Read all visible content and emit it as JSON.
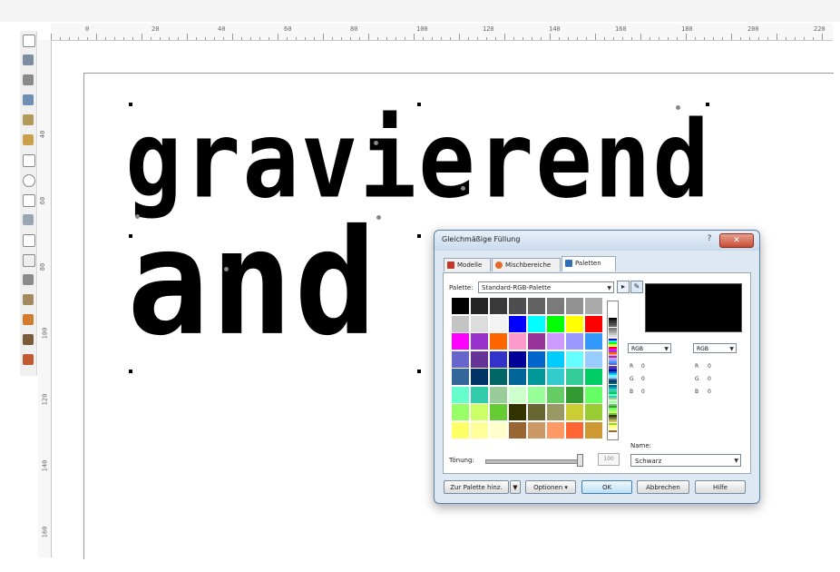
{
  "canvas": {
    "line1": "gravierend",
    "line2": "and"
  },
  "rulers": {
    "horizontal_labels": [
      "0",
      "20",
      "40",
      "60",
      "80",
      "100",
      "120",
      "140",
      "160",
      "180",
      "200",
      "220"
    ],
    "vertical_labels": [
      "40",
      "60",
      "80",
      "100",
      "120",
      "140",
      "160"
    ]
  },
  "dialog": {
    "title": "Gleichmäßige Füllung",
    "help_label": "?",
    "close_label": "✕",
    "tabs": [
      {
        "label": "Modelle",
        "icon": "models-icon",
        "active": false
      },
      {
        "label": "Mischbereiche",
        "icon": "mixer-icon",
        "active": false
      },
      {
        "label": "Paletten",
        "icon": "palette-icon",
        "active": true
      }
    ],
    "palette_label": "Palette:",
    "palette_value": "Standard-RGB-Palette",
    "color_model_left": "RGB",
    "color_model_right": "RGB",
    "channels_left": [
      {
        "name": "R",
        "value": "0"
      },
      {
        "name": "G",
        "value": "0"
      },
      {
        "name": "B",
        "value": "0"
      }
    ],
    "channels_right": [
      {
        "name": "R",
        "value": "0"
      },
      {
        "name": "G",
        "value": "0"
      },
      {
        "name": "B",
        "value": "0"
      }
    ],
    "name_label": "Name:",
    "name_value": "Schwarz",
    "tint_label": "Tönung:",
    "tint_value": "100",
    "preview_color": "#000000",
    "buttons": {
      "to_palette": "Zur Palette hinz.",
      "options": "Optionen",
      "ok": "OK",
      "cancel": "Abbrechen",
      "help": "Hilfe"
    },
    "swatches": [
      [
        "#000000",
        "#262626",
        "#3a3a3a",
        "#4e4e4e",
        "#636363",
        "#7a7a7a",
        "#919191",
        "#aaaaaa"
      ],
      [
        "#c4c4c4",
        "#dcdcdc",
        "#f3f3f3",
        "#0000ff",
        "#00ffff",
        "#00ff00",
        "#ffff00",
        "#ff0000"
      ],
      [
        "#ff00ff",
        "#9933cc",
        "#ff6600",
        "#ff99cc",
        "#993399",
        "#cc99ff",
        "#9999ff",
        "#3399ff"
      ],
      [
        "#6666cc",
        "#663399",
        "#3333cc",
        "#000099",
        "#0066cc",
        "#00ccff",
        "#66ffff",
        "#99ccff"
      ],
      [
        "#336699",
        "#003366",
        "#006666",
        "#006699",
        "#009999",
        "#33cccc",
        "#33cc99",
        "#00cc66"
      ],
      [
        "#66ffcc",
        "#33ccaa",
        "#99cc99",
        "#ccffcc",
        "#99ff99",
        "#66cc66",
        "#339933",
        "#66ff66"
      ],
      [
        "#99ff66",
        "#ccff66",
        "#66cc33",
        "#333300",
        "#666633",
        "#999966",
        "#cccc33",
        "#99cc33"
      ],
      [
        "#ffff66",
        "#ffff99",
        "#ffffcc",
        "#996633",
        "#cc9966",
        "#ff9966",
        "#ff6633",
        "#cc9933"
      ]
    ]
  }
}
